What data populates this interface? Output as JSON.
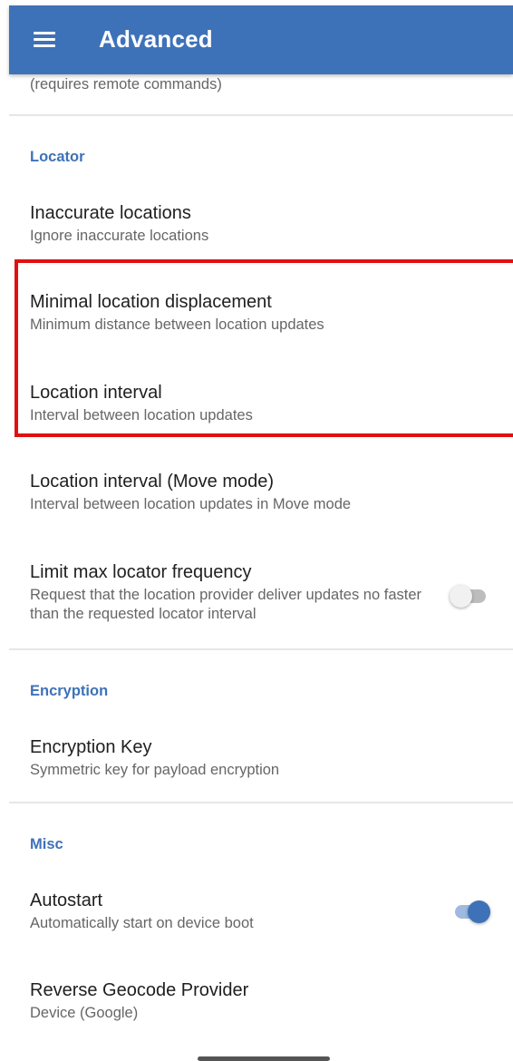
{
  "appbar": {
    "title": "Advanced",
    "menu_icon": "menu-icon",
    "background": "#3e72b8"
  },
  "scrolled_item": {
    "summary": "(requires remote commands)"
  },
  "sections": {
    "locator": {
      "title": "Locator",
      "items": [
        {
          "title": "Inaccurate locations",
          "summary": "Ignore inaccurate locations"
        },
        {
          "title": "Minimal location displacement",
          "summary": "Minimum distance between location updates"
        },
        {
          "title": "Location interval",
          "summary": "Interval between location updates"
        },
        {
          "title": "Location interval (Move mode)",
          "summary": "Interval between location updates in Move mode"
        },
        {
          "title": "Limit max locator frequency",
          "summary": "Request that the location provider deliver updates no faster than the requested locator interval",
          "switch": false
        }
      ]
    },
    "encryption": {
      "title": "Encryption",
      "items": [
        {
          "title": "Encryption Key",
          "summary": "Symmetric key for payload encryption"
        }
      ]
    },
    "misc": {
      "title": "Misc",
      "items": [
        {
          "title": "Autostart",
          "summary": "Automatically start on device boot",
          "switch": true
        },
        {
          "title": "Reverse Geocode Provider",
          "summary": "Device (Google)"
        }
      ]
    }
  },
  "colors": {
    "accent": "#3e72b8",
    "highlight": "#e01010"
  }
}
